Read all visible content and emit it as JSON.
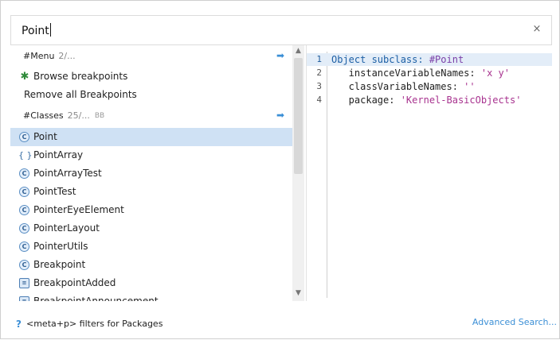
{
  "search": {
    "value": "Point",
    "close_symbol": "×"
  },
  "results": {
    "menu_category": {
      "label": "#Menu",
      "count": "2/...",
      "arrow": "➡"
    },
    "menu_items": [
      {
        "label": "Browse breakpoints",
        "icon": "bug-icon"
      },
      {
        "label": "Remove all Breakpoints",
        "icon": ""
      }
    ],
    "classes_category": {
      "label": "#Classes",
      "count": "25/...",
      "badge": "BB",
      "arrow": "➡"
    },
    "class_items": [
      {
        "label": "Point",
        "icon": "class-icon",
        "glyph": "C",
        "selected": true
      },
      {
        "label": "PointArray",
        "icon": "braces-icon",
        "glyph": "{ }"
      },
      {
        "label": "PointArrayTest",
        "icon": "class-icon",
        "glyph": "C"
      },
      {
        "label": "PointTest",
        "icon": "class-icon",
        "glyph": "C"
      },
      {
        "label": "PointerEyeElement",
        "icon": "class-icon",
        "glyph": "C"
      },
      {
        "label": "PointerLayout",
        "icon": "class-icon",
        "glyph": "C"
      },
      {
        "label": "PointerUtils",
        "icon": "class-icon",
        "glyph": "C"
      },
      {
        "label": "Breakpoint",
        "icon": "class-icon",
        "glyph": "C"
      },
      {
        "label": "BreakpointAdded",
        "icon": "message-icon",
        "glyph": "≡"
      },
      {
        "label": "BreakpointAnnouncement",
        "icon": "message-icon",
        "glyph": "≡"
      }
    ]
  },
  "scrollbar": {
    "up": "▲",
    "down": "▼"
  },
  "code": {
    "lines": [
      {
        "num": "1",
        "a": "Object subclass: ",
        "b": "#Point",
        "c": ""
      },
      {
        "num": "2",
        "a": "   instanceVariableNames: ",
        "b": "",
        "c": "'x y'"
      },
      {
        "num": "3",
        "a": "   classVariableNames: ",
        "b": "",
        "c": "''"
      },
      {
        "num": "4",
        "a": "   package: ",
        "b": "",
        "c": "'Kernel-BasicObjects'"
      }
    ]
  },
  "footer": {
    "help_mark": "?",
    "help_text": "<meta+p> filters for Packages",
    "advanced_link": "Advanced Search..."
  },
  "colors": {
    "accent": "#3b8fd6",
    "selection": "#cfe1f4",
    "current_line": "#e3edf8"
  }
}
